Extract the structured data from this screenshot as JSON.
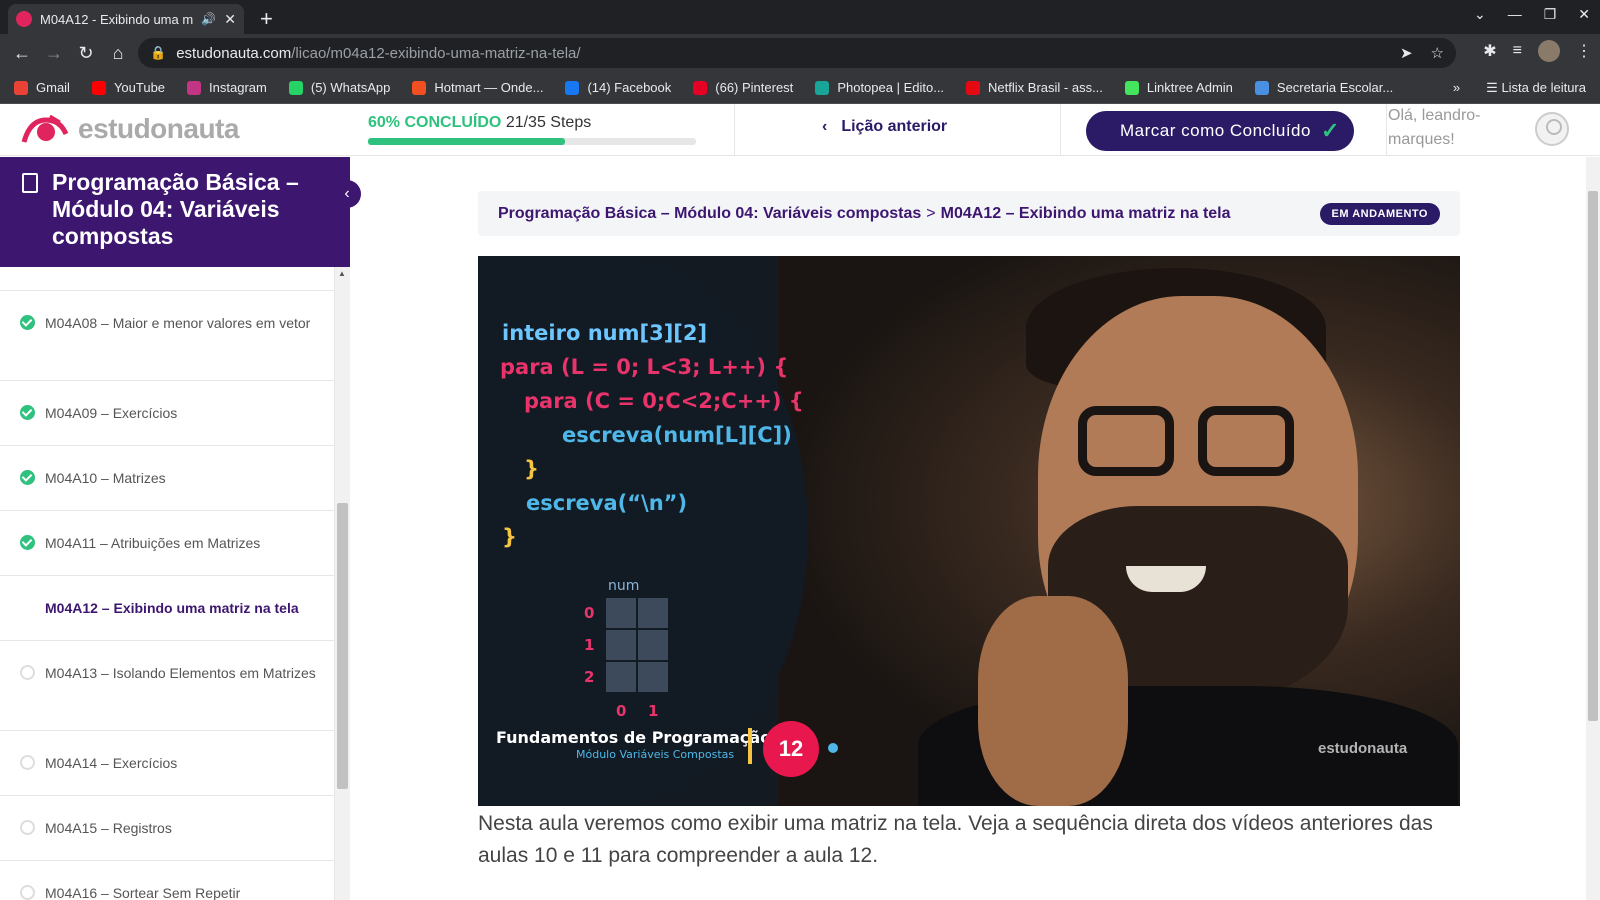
{
  "browser": {
    "tab_title": "M04A12 - Exibindo uma m",
    "url_host": "estudonauta.com",
    "url_path": "/licao/m04a12-exibindo-uma-matriz-na-tela/",
    "bookmarks": [
      {
        "label": "Gmail",
        "color": "#ea4335"
      },
      {
        "label": "YouTube",
        "color": "#ff0000"
      },
      {
        "label": "Instagram",
        "color": "#c13584"
      },
      {
        "label": "(5) WhatsApp",
        "color": "#25d366"
      },
      {
        "label": "Hotmart — Onde...",
        "color": "#f04e23"
      },
      {
        "label": "(14) Facebook",
        "color": "#1877f2"
      },
      {
        "label": "(66) Pinterest",
        "color": "#e60023"
      },
      {
        "label": "Photopea | Edito...",
        "color": "#18a497"
      },
      {
        "label": "Netflix Brasil - ass...",
        "color": "#e50914"
      },
      {
        "label": "Linktree Admin",
        "color": "#43e55e"
      },
      {
        "label": "Secretaria Escolar...",
        "color": "#4a90e2"
      }
    ],
    "more_label": "»",
    "reading_list": "Lista de leitura"
  },
  "header": {
    "logo_text": "estudonauta",
    "progress_pct_label": "60% CONCLUÍDO",
    "progress_steps": "21/35 Steps",
    "progress_fraction": 0.6,
    "prev_lesson": "Lição anterior",
    "mark_complete": "Marcar como Concluído",
    "greeting": "Olá, leandro-marques!"
  },
  "sidebar": {
    "course_title": "Programação Básica – Módulo 04: Variáveis compostas",
    "lessons": [
      {
        "label": "M04A08 – Maior e menor valores em vetor",
        "status": "done"
      },
      {
        "label": "M04A09 – Exercícios",
        "status": "done"
      },
      {
        "label": "M04A10 – Matrizes",
        "status": "done"
      },
      {
        "label": "M04A11 – Atribuições em Matrizes",
        "status": "done"
      },
      {
        "label": "M04A12 – Exibindo uma matriz na tela",
        "status": "current"
      },
      {
        "label": "M04A13 – Isolando Elementos em Matrizes",
        "status": "todo"
      },
      {
        "label": "M04A14 – Exercícios",
        "status": "todo"
      },
      {
        "label": "M04A15 – Registros",
        "status": "todo"
      },
      {
        "label": "M04A16 – Sortear Sem Repetir",
        "status": "todo"
      }
    ]
  },
  "main": {
    "breadcrumb_course": "Programação Básica – Módulo 04: Variáveis compostas",
    "breadcrumb_sep": ">",
    "breadcrumb_lesson": "M04A12 – Exibindo uma matriz na tela",
    "status": "EM ANDAMENTO",
    "video": {
      "code_lines": [
        "inteiro num[3][2]",
        "para (L = 0; L<3; L++) {",
        "para (C = 0;C<2;C++) {",
        "escreva(num[L][C])",
        "}",
        "escreva(“\\n”)",
        "}"
      ],
      "matrix_label": "num",
      "row_indices": [
        "0",
        "1",
        "2"
      ],
      "col_indices": [
        "0",
        "1"
      ],
      "footer_title": "Fundamentos de Programação",
      "footer_subtitle": "Módulo Variáveis Compostas",
      "episode": "12",
      "watermark": "estudonauta"
    },
    "description": "Nesta aula veremos como exibir uma matriz na tela. Veja a sequência direta dos vídeos anteriores das aulas 10 e 11 para compreender a aula 12."
  }
}
